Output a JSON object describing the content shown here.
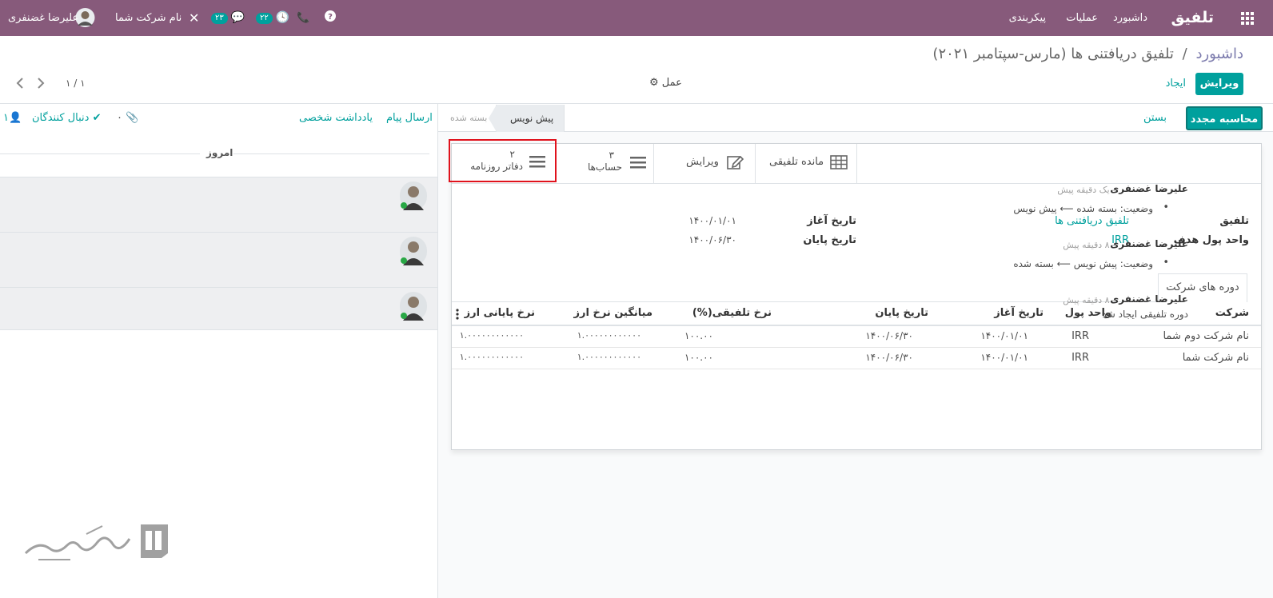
{
  "topbar": {
    "app_title": "تلفیق",
    "menu": [
      "داشبورد",
      "عملیات",
      "پیکربندی"
    ],
    "user_name": "علیرضا غضنفری",
    "company": "نام شرکت شما",
    "activity_badge": "۲۲",
    "message_badge": "۲۳",
    "colors": {
      "bar": "#875a7b",
      "accent": "#00a09d"
    }
  },
  "breadcrumb": {
    "root": "داشبورد",
    "separator": "/",
    "current": "تلفیق دریافتنی ها (مارس-سپتامبر ۲۰۲۱)"
  },
  "control": {
    "edit": "ویرایش",
    "create": "ایجاد",
    "action": "عمل",
    "pager": "۱ / ۱"
  },
  "statusbar": {
    "recompute": "محاسبه مجدد",
    "close": "بستن",
    "stages": [
      "بسته شده",
      "پیش نویس"
    ],
    "active_stage": "پیش نویس"
  },
  "smart_buttons": [
    {
      "label": "مانده تلفیقی",
      "icon": "table-icon"
    },
    {
      "label": "ویرایش",
      "icon": "edit-icon"
    },
    {
      "count": "۳",
      "label": "حساب‌ها",
      "icon": "list-icon"
    },
    {
      "count": "۲",
      "label": "دفاتر روزنامه",
      "icon": "list-icon"
    }
  ],
  "fields": {
    "consolidation_label": "تلفیق",
    "consolidation_value": "تلفیق دریافتنی ها",
    "currency_label": "واحد پول هدف",
    "currency_value": "IRR",
    "start_label": "تاریخ آغاز",
    "start_value": "۱۴۰۰/۰۱/۰۱",
    "end_label": "تاریخ پایان",
    "end_value": "۱۴۰۰/۰۶/۳۰"
  },
  "tab": "دوره های شرکت",
  "table": {
    "headers": [
      "شرکت",
      "واحد پول",
      "تاریخ آغاز",
      "تاریخ پایان",
      "نرخ تلفیقی(%)",
      "میانگین نرخ ارز",
      "نرخ پایانی ارز"
    ],
    "rows": [
      [
        "نام شرکت دوم شما",
        "IRR",
        "۱۴۰۰/۰۱/۰۱",
        "۱۴۰۰/۰۶/۳۰",
        "۱۰۰.۰۰",
        "۱.۰۰۰۰۰۰۰۰۰۰۰۰",
        "۱.۰۰۰۰۰۰۰۰۰۰۰۰"
      ],
      [
        "نام شرکت شما",
        "IRR",
        "۱۴۰۰/۰۱/۰۱",
        "۱۴۰۰/۰۶/۳۰",
        "۱۰۰.۰۰",
        "۱.۰۰۰۰۰۰۰۰۰۰۰۰",
        "۱.۰۰۰۰۰۰۰۰۰۰۰۰"
      ]
    ]
  },
  "chatter": {
    "send_message": "ارسال پیام",
    "log_note": "یادداشت شخصی",
    "attachments": "۰",
    "followers": "دنبال کنندگان",
    "follower_count": "۱",
    "today": "امروز",
    "messages": [
      {
        "author": "علیرضا غضنفری",
        "time": "- یک دقیقه پیش",
        "body": "وضعیت: بسته شده ⟵ پیش نویس",
        "bullet": "•"
      },
      {
        "author": "علیرضا غضنفری",
        "time": "- ۸ دقیقه پیش",
        "body": "وضعیت: پیش نویس ⟵ بسته شده",
        "bullet": "•"
      },
      {
        "author": "علیرضا غضنفری",
        "time": "- ۸ دقیقه پیش",
        "body": "دوره تلفیقی ایجاد شد"
      }
    ]
  }
}
